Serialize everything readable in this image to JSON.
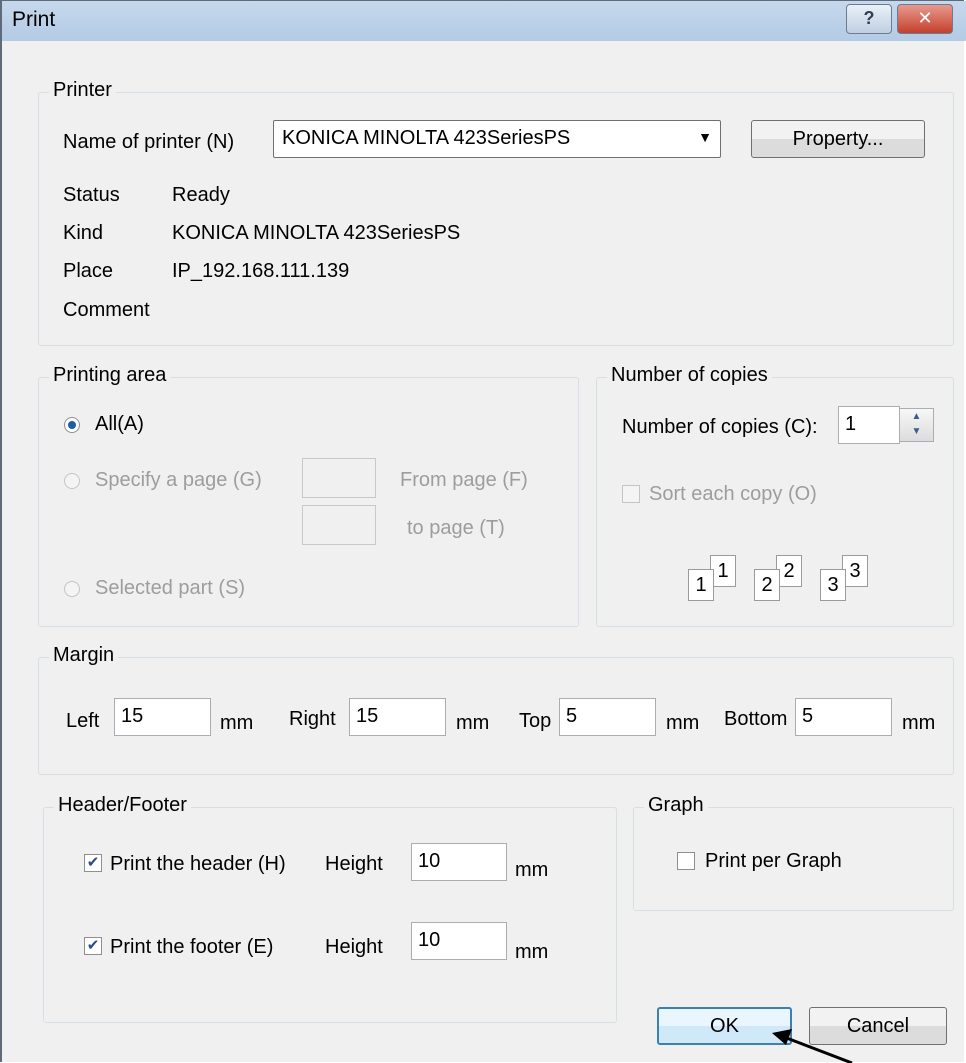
{
  "window": {
    "title": "Print",
    "help_glyph": "?",
    "close_glyph": "✕"
  },
  "printer": {
    "legend": "Printer",
    "name_label": "Name of printer (N)",
    "name_value": "KONICA MINOLTA 423SeriesPS",
    "property_button": "Property...",
    "status_label": "Status",
    "status_value": "Ready",
    "kind_label": "Kind",
    "kind_value": "KONICA MINOLTA 423SeriesPS",
    "place_label": "Place",
    "place_value": "IP_192.168.111.139",
    "comment_label": "Comment"
  },
  "printing_area": {
    "legend": "Printing area",
    "all_label": "All(A)",
    "specify_label": "Specify a page (G)",
    "from_label": "From page (F)",
    "to_label": "to page (T)",
    "selected_label": "Selected part (S)"
  },
  "copies": {
    "legend": "Number of copies",
    "count_label": "Number of copies (C):",
    "count_value": "1",
    "sort_label": "Sort each copy (O)",
    "collate_digits": [
      "1",
      "1",
      "2",
      "2",
      "3",
      "3"
    ]
  },
  "margin": {
    "legend": "Margin",
    "left_label": "Left",
    "left_value": "15",
    "right_label": "Right",
    "right_value": "15",
    "top_label": "Top",
    "top_value": "5",
    "bottom_label": "Bottom",
    "bottom_value": "5",
    "unit": "mm"
  },
  "header_footer": {
    "legend": "Header/Footer",
    "header_label": "Print the header (H)",
    "footer_label": "Print the footer (E)",
    "height_label": "Height",
    "header_height": "10",
    "footer_height": "10",
    "unit": "mm",
    "check_glyph": "✔"
  },
  "graph": {
    "legend": "Graph",
    "per_graph_label": "Print per Graph"
  },
  "buttons": {
    "ok": "OK",
    "cancel": "Cancel"
  },
  "colors": {
    "titlebar": "#b9cfe7",
    "dialog_bg": "#f0f0f0",
    "close_red": "#c4402e",
    "default_border": "#3c7fb1"
  }
}
